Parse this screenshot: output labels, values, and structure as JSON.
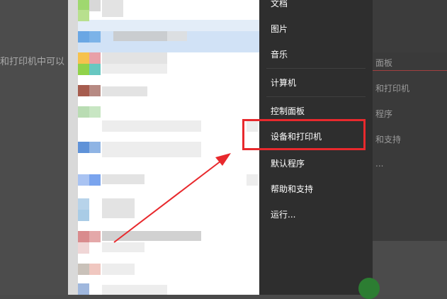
{
  "background": {
    "left_partial_text": "和打印机中可以",
    "right_items": [
      "面板",
      "和打印机",
      "程序",
      "和支持",
      "..."
    ]
  },
  "start_menu": {
    "right_column": {
      "items": [
        {
          "label": "文档"
        },
        {
          "label": "图片"
        },
        {
          "label": "音乐"
        },
        {
          "label": "计算机"
        },
        {
          "label": "控制面板"
        },
        {
          "label": "设备和打印机"
        },
        {
          "label": "默认程序"
        },
        {
          "label": "帮助和支持"
        },
        {
          "label": "运行..."
        }
      ]
    }
  },
  "annotation": {
    "highlight_color": "#e8292d",
    "target": "设备和打印机"
  },
  "colors": {
    "menu_bg": "#2e2e2e",
    "menu_text": "#ffffff",
    "panel_bg": "#ffffff",
    "selection": "#d1e2f6"
  }
}
